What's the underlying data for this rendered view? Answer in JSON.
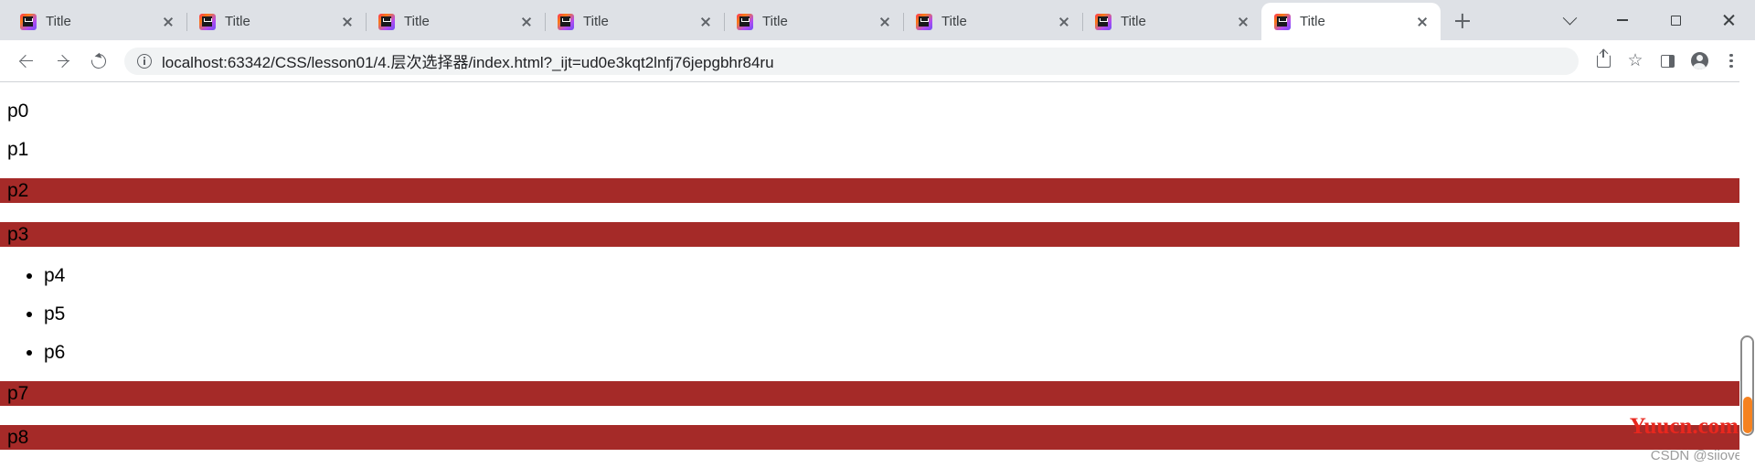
{
  "browser": {
    "tabs": [
      {
        "title": "Title",
        "favicon": "intellij-idea-icon",
        "active": false
      },
      {
        "title": "Title",
        "favicon": "intellij-idea-icon",
        "active": false
      },
      {
        "title": "Title",
        "favicon": "intellij-idea-icon",
        "active": false
      },
      {
        "title": "Title",
        "favicon": "intellij-idea-icon",
        "active": false
      },
      {
        "title": "Title",
        "favicon": "intellij-idea-icon",
        "active": false
      },
      {
        "title": "Title",
        "favicon": "intellij-idea-icon",
        "active": false
      },
      {
        "title": "Title",
        "favicon": "intellij-idea-icon",
        "active": false
      },
      {
        "title": "Title",
        "favicon": "intellij-idea-icon",
        "active": true
      }
    ],
    "new_tab_label": "+",
    "window_controls": {
      "tab_search": "chevron-down-icon",
      "minimize": "minimize-icon",
      "maximize": "maximize-icon",
      "close": "close-icon"
    },
    "toolbar": {
      "back": "back-arrow-icon",
      "forward": "forward-arrow-icon",
      "reload": "reload-icon",
      "site_info": "info-circle-icon",
      "url": "localhost:63342/CSS/lesson01/4.层次选择器/index.html?_ijt=ud0e3kqt2lnfj76jepgbhr84ru",
      "url_placeholder": "Search Google or type a URL",
      "share": "share-icon",
      "bookmark": "star-icon",
      "side_panel": "side-panel-icon",
      "profile": "avatar-icon",
      "menu": "three-dots-menu-icon"
    }
  },
  "page": {
    "highlight_color": "#a52a28",
    "blocks": [
      {
        "kind": "paragraph",
        "text": "p0",
        "highlighted": false
      },
      {
        "kind": "paragraph",
        "text": "p1",
        "highlighted": false
      },
      {
        "kind": "paragraph",
        "text": "p2",
        "highlighted": true
      },
      {
        "kind": "paragraph",
        "text": "p3",
        "highlighted": true
      }
    ],
    "list_items": [
      "p4",
      "p5",
      "p6"
    ],
    "trailing_blocks": [
      {
        "kind": "paragraph",
        "text": "p7",
        "highlighted": true
      },
      {
        "kind": "paragraph",
        "text": "p8",
        "highlighted": true
      }
    ],
    "watermarks": {
      "site": "Yuucn.com",
      "site_color": "#e8271e",
      "credit": "CSDN @siiove",
      "credit_color": "#9b9b9b"
    }
  }
}
